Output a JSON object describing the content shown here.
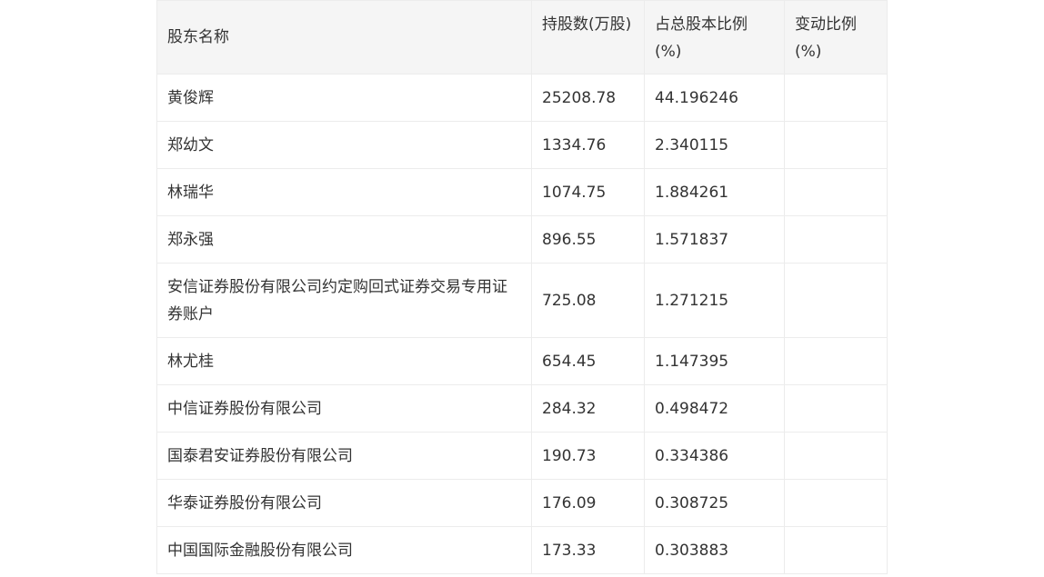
{
  "table": {
    "headers": [
      "股东名称",
      "持股数(万股)",
      "占总股本比例(%)",
      "变动比例(%)"
    ],
    "rows": [
      {
        "name": "黄俊辉",
        "shares": "25208.78",
        "ratio": "44.196246",
        "change": ""
      },
      {
        "name": "郑幼文",
        "shares": "1334.76",
        "ratio": "2.340115",
        "change": ""
      },
      {
        "name": "林瑞华",
        "shares": "1074.75",
        "ratio": "1.884261",
        "change": ""
      },
      {
        "name": "郑永强",
        "shares": "896.55",
        "ratio": "1.571837",
        "change": ""
      },
      {
        "name": "安信证券股份有限公司约定购回式证券交易专用证券账户",
        "shares": "725.08",
        "ratio": "1.271215",
        "change": ""
      },
      {
        "name": "林尤桂",
        "shares": "654.45",
        "ratio": "1.147395",
        "change": ""
      },
      {
        "name": "中信证券股份有限公司",
        "shares": "284.32",
        "ratio": "0.498472",
        "change": ""
      },
      {
        "name": "国泰君安证券股份有限公司",
        "shares": "190.73",
        "ratio": "0.334386",
        "change": ""
      },
      {
        "name": "华泰证券股份有限公司",
        "shares": "176.09",
        "ratio": "0.308725",
        "change": ""
      },
      {
        "name": "中国国际金融股份有限公司",
        "shares": "173.33",
        "ratio": "0.303883",
        "change": ""
      }
    ]
  }
}
